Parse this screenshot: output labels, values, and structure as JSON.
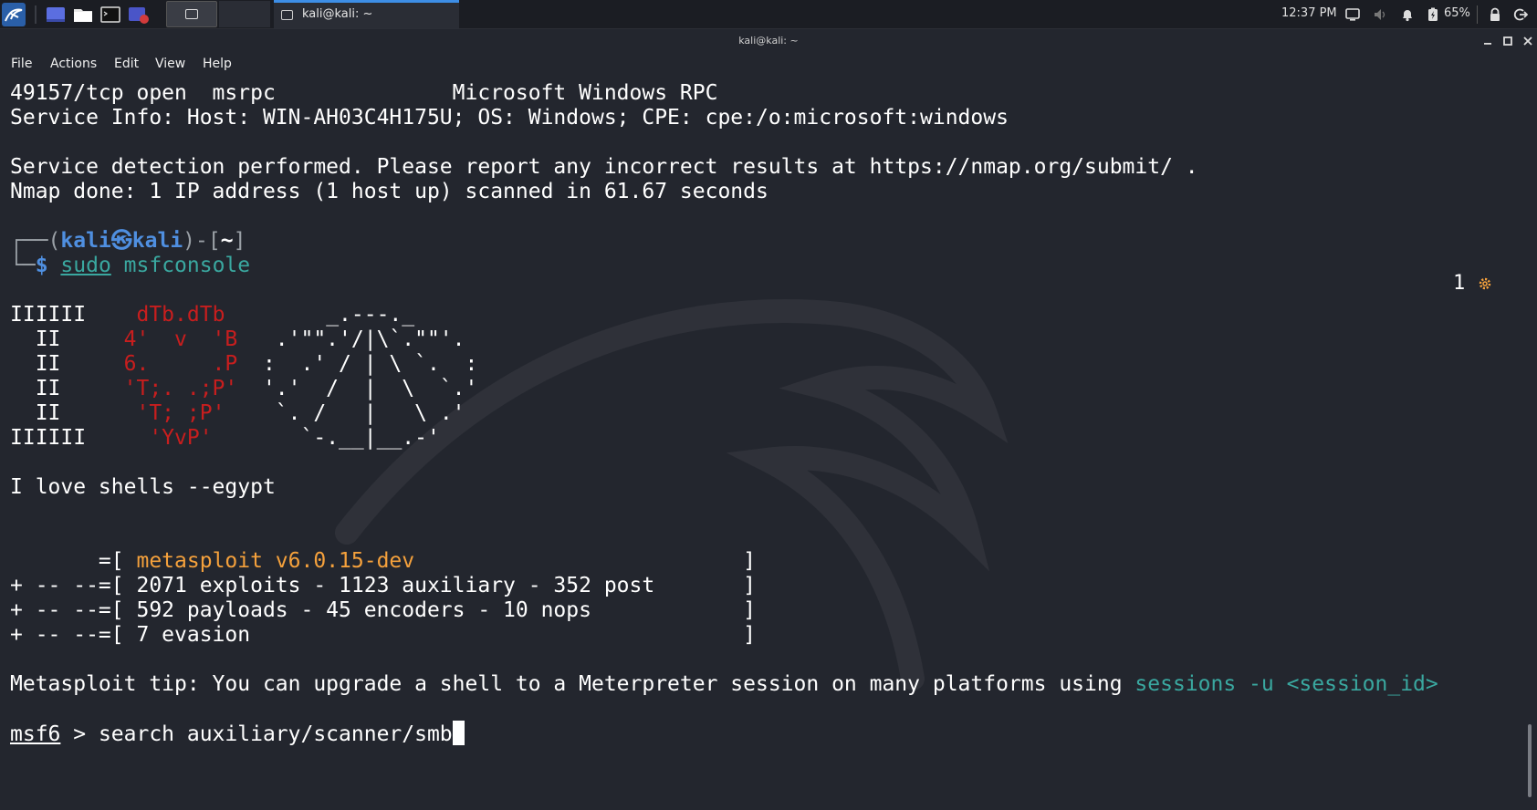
{
  "panel": {
    "taskbar_title": "kali@kali: ~",
    "clock": "12:37 PM",
    "battery_percent": "65%"
  },
  "window": {
    "title": "kali@kali: ~",
    "menu": [
      "File",
      "Actions",
      "Edit",
      "View",
      "Help"
    ]
  },
  "terminal": {
    "lines": {
      "l1": "49157/tcp open  msrpc              Microsoft Windows RPC",
      "l2": "Service Info: Host: WIN-AH03C4H175U; OS: Windows; CPE: cpe:/o:microsoft:windows",
      "l3": "Service detection performed. Please report any incorrect results at https://nmap.org/submit/ .",
      "l4": "Nmap done: 1 IP address (1 host up) scanned in 61.67 seconds"
    },
    "prompt": {
      "user": "kali",
      "host": "kali",
      "dir": "~",
      "cmd_sudo": "sudo",
      "cmd_rest": "msfconsole",
      "right_indicator": "1"
    },
    "banner": {
      "r1_left": "IIIIII    ",
      "r1_red": "dTb.dTb",
      "r1_art": "        _.---._",
      "r2_left": "  II     ",
      "r2_red": "4'  v  'B",
      "r2_art": "   .'\"\".'/|\\`.\"\"'.",
      "r3_left": "  II     ",
      "r3_red": "6.     .P",
      "r3_art": "  :  .' / | \\ `.  :",
      "r4_left": "  II     ",
      "r4_red": "'T;. .;P'",
      "r4_art": "  '.'  /  |  \\  `.'",
      "r5_left": "  II      ",
      "r5_red": "'T; ;P'",
      "r5_art": "    `. /   |   \\ .'",
      "r6_left": "IIIIII     ",
      "r6_red": "'YvP'",
      "r6_art": "       `-.__|__.-'"
    },
    "love": "I love shells --egypt",
    "msf": {
      "v_prefix": "       =[ ",
      "version": "metasploit v6.0.15-dev",
      "v_suffix": "                          ]",
      "s1": "+ -- --=[ 2071 exploits - 1123 auxiliary - 352 post       ]",
      "s2": "+ -- --=[ 592 payloads - 45 encoders - 10 nops            ]",
      "s3": "+ -- --=[ 7 evasion                                       ]"
    },
    "tip": {
      "text": "Metasploit tip: You can upgrade a shell to a Meterpreter session on many platforms using ",
      "cmd": "sessions -u <session_id>"
    },
    "input": {
      "prompt": "msf6",
      "sep": " > ",
      "command": "search auxiliary/scanner/smb"
    }
  }
}
